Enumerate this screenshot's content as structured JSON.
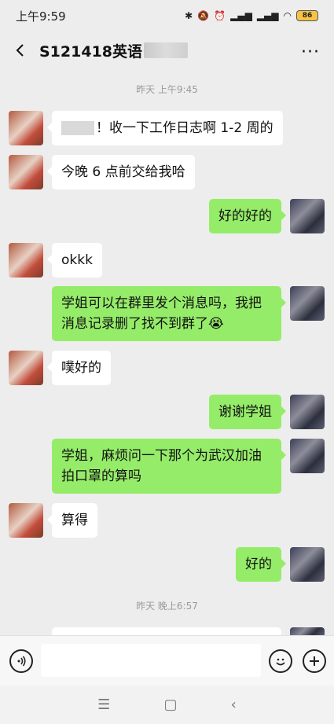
{
  "status_bar": {
    "time": "上午9:59",
    "battery": "86"
  },
  "header": {
    "title": "S121418英语",
    "more": "···"
  },
  "timestamps": [
    "昨天 上午9:45",
    "昨天 晚上6:57"
  ],
  "messages": [
    {
      "side": "in",
      "text": "！收一下工作日志啊 1-2 周的"
    },
    {
      "side": "in",
      "text": "今晚 6 点前交给我哈"
    },
    {
      "side": "out",
      "text": "好的好的"
    },
    {
      "side": "in",
      "text": "okkk"
    },
    {
      "side": "out",
      "line1": "学姐可以在群里发个消息吗，我把",
      "line2": "消息记录删了找不到群了😭"
    },
    {
      "side": "in",
      "text": "噗好的"
    },
    {
      "side": "out",
      "text": "谢谢学姐"
    },
    {
      "side": "out",
      "line1": "学姐，麻烦问一下那个为武汉加油",
      "line2": "拍口罩的算吗"
    },
    {
      "side": "in",
      "text": "算得"
    },
    {
      "side": "out",
      "text": "好的"
    }
  ],
  "input_bar": {
    "voice_icon": "voice-icon",
    "emoji_icon": "emoji-icon",
    "plus_icon": "plus-icon"
  },
  "system_nav": {
    "menu": "☰",
    "home": "▢",
    "back": "‹"
  }
}
